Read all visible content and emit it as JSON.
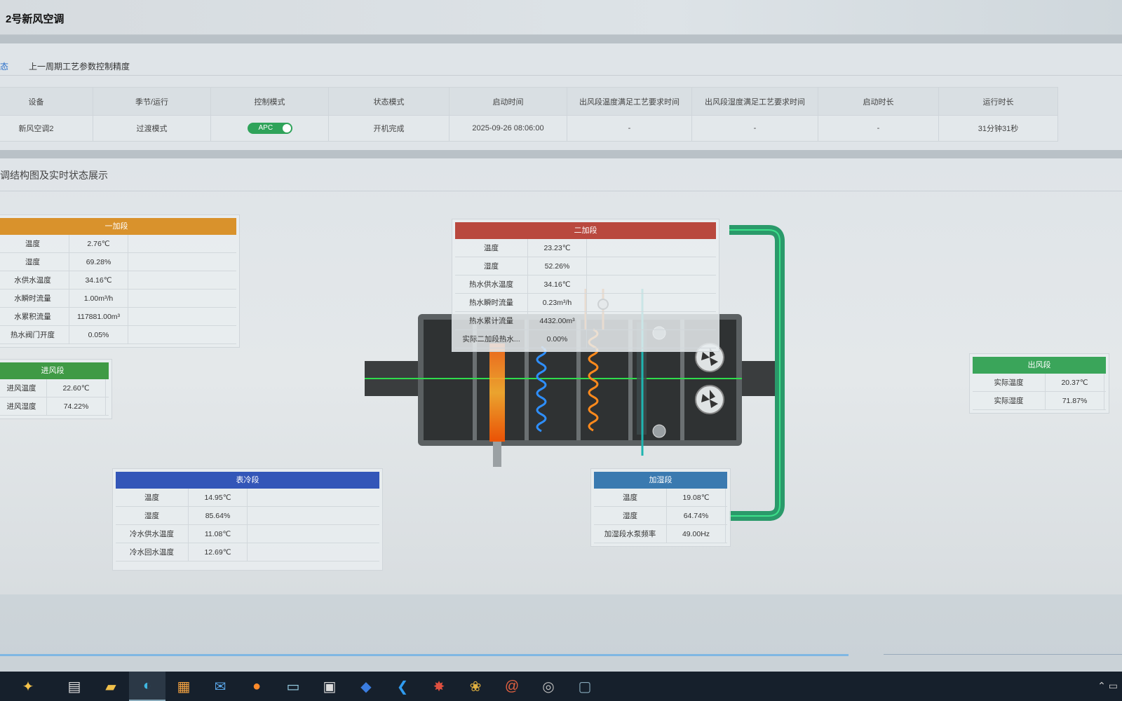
{
  "window": {
    "title": "2号新风空调"
  },
  "tabs": [
    {
      "label": "态"
    },
    {
      "label": "上一周期工艺参数控制精度"
    }
  ],
  "status_table": {
    "headers": [
      "设备",
      "季节/运行",
      "控制模式",
      "状态模式",
      "启动时间",
      "出风段温度满足工艺要求时间",
      "出风段湿度满足工艺要求时间",
      "启动时长",
      "运行时长"
    ],
    "row": {
      "device": "新风空调2",
      "season": "过渡模式",
      "control_mode": "APC",
      "state_mode": "开机完成",
      "start_time": "2025-09-26 08:06:00",
      "temp_ok_time": "-",
      "hum_ok_time": "-",
      "start_duration": "-",
      "run_duration": "31分钟31秒"
    }
  },
  "section_title": "调结构图及实时状态展示",
  "cards": {
    "preheat": {
      "title": "一加段",
      "color": "#d9922c",
      "rows": [
        {
          "k": "温度",
          "v": "2.76℃"
        },
        {
          "k": "湿度",
          "v": "69.28%"
        },
        {
          "k": "水供水温度",
          "v": "34.16℃"
        },
        {
          "k": "水瞬时流量",
          "v": "1.00m³/h"
        },
        {
          "k": "水累积流量",
          "v": "117881.00m³"
        },
        {
          "k": "热水阀门开度",
          "v": "0.05%"
        }
      ]
    },
    "inlet": {
      "title": "进风段",
      "color": "#3f9a45",
      "rows": [
        {
          "k": "进风温度",
          "v": "22.60℃"
        },
        {
          "k": "进风湿度",
          "v": "74.22%"
        }
      ]
    },
    "reheat": {
      "title": "二加段",
      "color": "#b9483e",
      "rows": [
        {
          "k": "温度",
          "v": "23.23℃"
        },
        {
          "k": "湿度",
          "v": "52.26%"
        },
        {
          "k": "热水供水温度",
          "v": "34.16℃"
        },
        {
          "k": "热水瞬时流量",
          "v": "0.23m³/h"
        },
        {
          "k": "热水累计流量",
          "v": "4432.00m³"
        },
        {
          "k": "实际二加段热水...",
          "v": "0.00%"
        }
      ]
    },
    "cooling": {
      "title": "表冷段",
      "color": "#3356b8",
      "rows": [
        {
          "k": "温度",
          "v": "14.95℃"
        },
        {
          "k": "湿度",
          "v": "85.64%"
        },
        {
          "k": "冷水供水温度",
          "v": "11.08℃"
        },
        {
          "k": "冷水回水温度",
          "v": "12.69℃"
        }
      ]
    },
    "humidify": {
      "title": "加湿段",
      "color": "#3a7ab0",
      "rows": [
        {
          "k": "温度",
          "v": "19.08℃"
        },
        {
          "k": "湿度",
          "v": "64.74%"
        },
        {
          "k": "加湿段水泵频率",
          "v": "49.00Hz"
        }
      ]
    },
    "outlet": {
      "title": "出风段",
      "color": "#3aa55a",
      "rows": [
        {
          "k": "实际温度",
          "v": "20.37℃"
        },
        {
          "k": "实际湿度",
          "v": "71.87%"
        }
      ]
    }
  },
  "taskbar": {
    "icons": [
      "copilot-icon",
      "task-view-icon",
      "file-explorer-icon",
      "edge-icon",
      "store-icon",
      "mail-icon",
      "firefox-icon",
      "notepad-icon",
      "terminal-icon",
      "app-icon",
      "vscode-icon",
      "app2-icon",
      "app3-icon",
      "app4-icon",
      "app5-icon",
      "remote-desktop-icon"
    ]
  }
}
